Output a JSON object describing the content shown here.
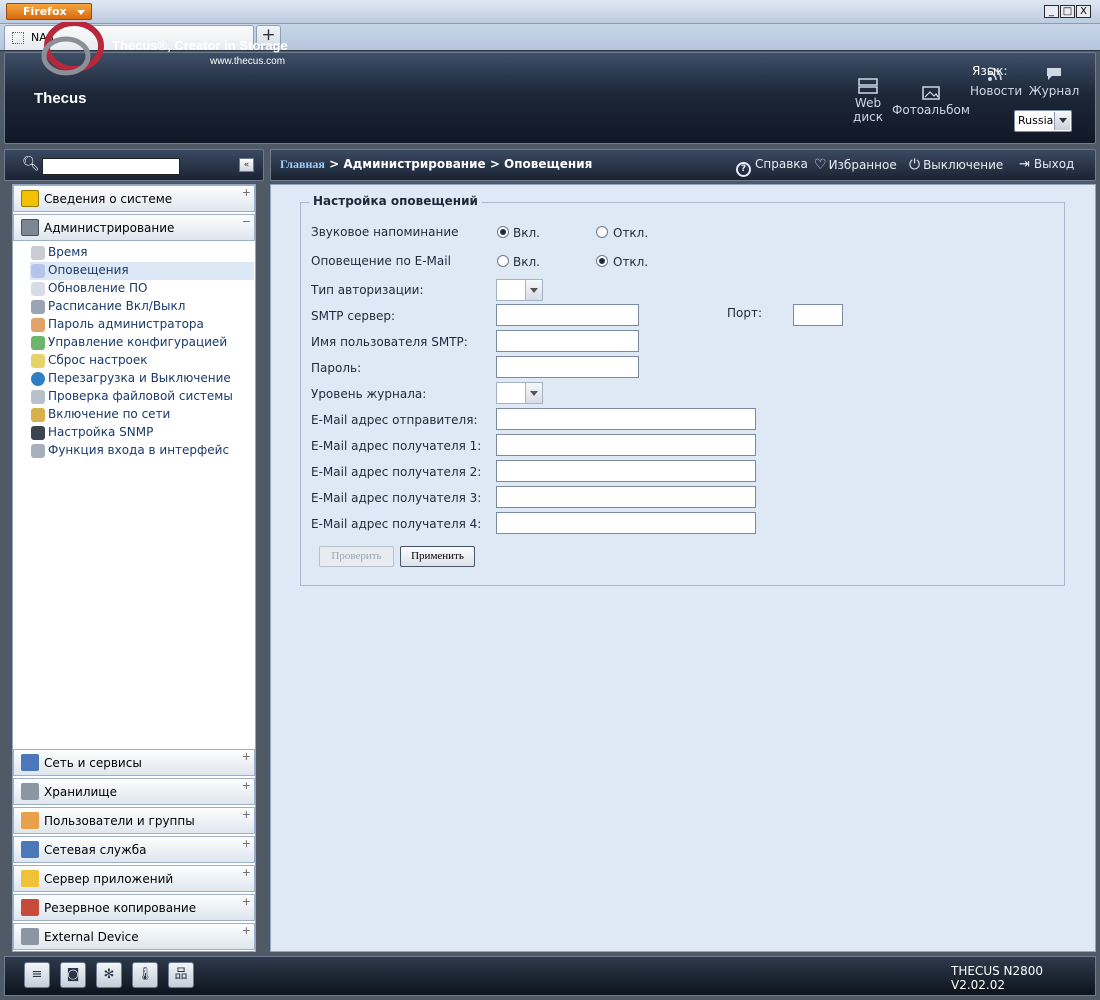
{
  "browser": {
    "menu_label": "Firefox",
    "tab_title": "NAS",
    "new_tab": "+",
    "win_min": "_",
    "win_max": "□",
    "win_close": "X"
  },
  "header": {
    "logo_text": "Thecus",
    "slogan": "Thecus®, Creator in Storage",
    "url": "www.thecus.com",
    "links": [
      {
        "label": "Web диск",
        "icon": "web-disk-icon"
      },
      {
        "label": "Фотоальбом",
        "icon": "photo-icon"
      },
      {
        "label": "Новости",
        "icon": "rss-icon"
      },
      {
        "label": "Журнал",
        "icon": "log-icon"
      }
    ],
    "lang_label": "Язык:",
    "lang_value": "Russia"
  },
  "sidebar": {
    "collapse": "«",
    "top_sections": [
      {
        "label": "Сведения о системе",
        "icon": "info-icon",
        "toggle": "+"
      },
      {
        "label": "Администрирование",
        "icon": "tools-icon",
        "toggle": "−"
      }
    ],
    "admin_items": [
      {
        "label": "Время",
        "icon": "clock-icon"
      },
      {
        "label": "Оповещения",
        "icon": "notification-icon"
      },
      {
        "label": "Обновление ПО",
        "icon": "update-icon"
      },
      {
        "label": "Расписание Вкл/Выкл",
        "icon": "schedule-icon"
      },
      {
        "label": "Пароль администратора",
        "icon": "admin-password-icon"
      },
      {
        "label": "Управление конфигурацией",
        "icon": "config-icon"
      },
      {
        "label": "Сброс настроек",
        "icon": "reset-icon"
      },
      {
        "label": "Перезагрузка и Выключение",
        "icon": "reboot-icon"
      },
      {
        "label": "Проверка файловой системы",
        "icon": "fs-check-icon"
      },
      {
        "label": "Включение по сети",
        "icon": "wol-icon"
      },
      {
        "label": "Настройка SNMP",
        "icon": "snmp-icon"
      },
      {
        "label": "Функция входа в интерфейс",
        "icon": "login-icon"
      }
    ],
    "bottom_sections": [
      {
        "label": "Сеть и сервисы",
        "icon": "network-icon",
        "toggle": "+"
      },
      {
        "label": "Хранилище",
        "icon": "storage-icon",
        "toggle": "+"
      },
      {
        "label": "Пользователи и группы",
        "icon": "users-icon",
        "toggle": "+"
      },
      {
        "label": "Сетевая служба",
        "icon": "network-service-icon",
        "toggle": "+"
      },
      {
        "label": "Сервер приложений",
        "icon": "app-server-icon",
        "toggle": "+"
      },
      {
        "label": "Резервное копирование",
        "icon": "backup-icon",
        "toggle": "+"
      },
      {
        "label": "External Device",
        "icon": "external-device-icon",
        "toggle": "+"
      }
    ]
  },
  "topbar": {
    "breadcrumb_home": "Главная",
    "breadcrumb_rest": " > Администрирование > Оповещения",
    "help": "Справка",
    "favorites": "Избранное",
    "shutdown": "Выключение",
    "logout": "Выход"
  },
  "form": {
    "legend": "Настройка оповещений",
    "beep_label": "Звуковое напоминание",
    "email_label": "Оповещение по E-Mail",
    "on": "Вкл.",
    "off": "Откл.",
    "beep_value": "on",
    "email_value": "off",
    "auth_label": "Тип авторизации:",
    "smtp_label": "SMTP сервер:",
    "port_label": "Порт:",
    "smtp_user_label": "Имя пользователя SMTP:",
    "password_label": "Пароль:",
    "log_level_label": "Уровень журнала:",
    "sender_label": "E-Mail адрес отправителя:",
    "rcpt1_label": "E-Mail адрес получателя 1:",
    "rcpt2_label": "E-Mail адрес получателя 2:",
    "rcpt3_label": "E-Mail адрес получателя 3:",
    "rcpt4_label": "E-Mail адрес получателя 4:",
    "check_button": "Проверить",
    "apply_button": "Применить"
  },
  "statusbar": {
    "icons": [
      "raid-status-icon",
      "disk-status-icon",
      "fan-status-icon",
      "temperature-icon",
      "network-status-icon"
    ],
    "version": "THECUS N2800 V2.02.02"
  }
}
